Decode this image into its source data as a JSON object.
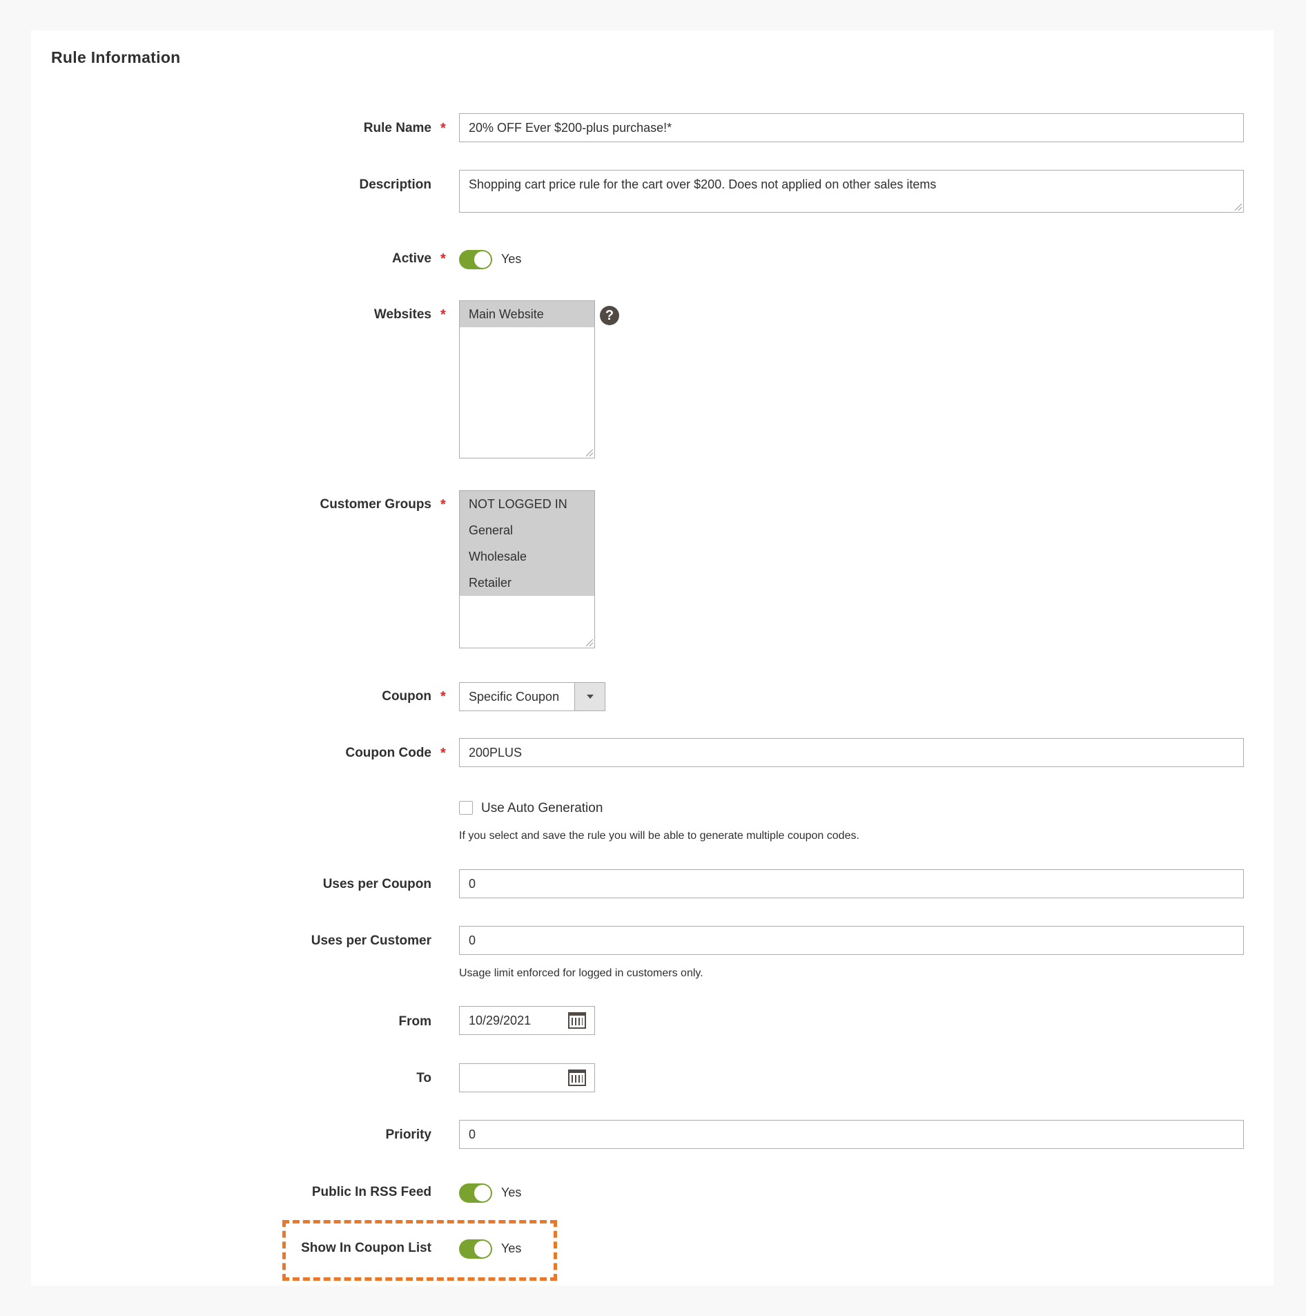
{
  "section": {
    "title": "Rule Information"
  },
  "fields": {
    "rule_name": {
      "label": "Rule Name",
      "value": "20% OFF Ever $200-plus purchase!*"
    },
    "description": {
      "label": "Description",
      "value": "Shopping cart price rule for the cart over $200. Does not applied on other sales items"
    },
    "active": {
      "label": "Active",
      "value": "Yes"
    },
    "websites": {
      "label": "Websites",
      "options": [
        "Main Website"
      ],
      "help": "?"
    },
    "customer_groups": {
      "label": "Customer Groups",
      "options": [
        "NOT LOGGED IN",
        "General",
        "Wholesale",
        "Retailer"
      ]
    },
    "coupon": {
      "label": "Coupon",
      "value": "Specific Coupon"
    },
    "coupon_code": {
      "label": "Coupon Code",
      "value": "200PLUS"
    },
    "auto_generation": {
      "label": "Use Auto Generation",
      "note": "If you select and save the rule you will be able to generate multiple coupon codes."
    },
    "uses_per_coupon": {
      "label": "Uses per Coupon",
      "value": "0"
    },
    "uses_per_customer": {
      "label": "Uses per Customer",
      "value": "0",
      "note": "Usage limit enforced for logged in customers only."
    },
    "from": {
      "label": "From",
      "value": "10/29/2021"
    },
    "to": {
      "label": "To",
      "value": ""
    },
    "priority": {
      "label": "Priority",
      "value": "0"
    },
    "public_rss": {
      "label": "Public In RSS Feed",
      "value": "Yes"
    },
    "show_in_coupon_list": {
      "label": "Show In Coupon List",
      "value": "Yes"
    }
  },
  "required_marker": "*",
  "colors": {
    "toggle_on": "#79a22e",
    "required": "#e22626",
    "highlight": "#e8792b"
  }
}
